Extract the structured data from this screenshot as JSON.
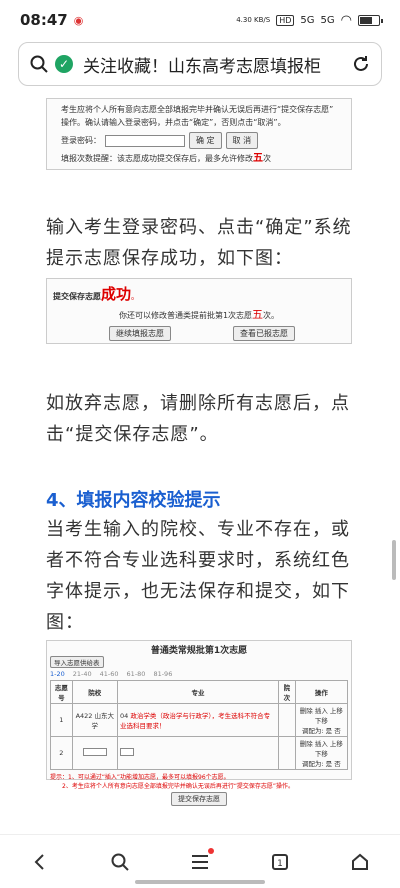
{
  "status": {
    "time": "08:47",
    "speed": "4.30\nKB/S",
    "net1": "HD",
    "net2": "5G",
    "net3": "5G"
  },
  "urlbar": {
    "text": "关注收藏！山东高考志愿填报柜"
  },
  "shot1": {
    "line1": "考生应将个人所有意向志愿全部填报完毕并确认无误后再进行“提交保存志愿”",
    "line2": "操作。确认请输入登录密码，并点击“确定”，否则点击“取消”。",
    "pw_label": "登录密码：",
    "ok": "确 定",
    "cancel": "取 消",
    "reminder_pre": "填报次数提醒：该志愿成功提交保存后，最多允许修改",
    "reminder_num": "五",
    "reminder_post": "次"
  },
  "para1": "输入考生登录密码、点击“确定”系统提示志愿保存成功，如下图：",
  "shot2": {
    "title_pre": "提交保存志愿",
    "title_big": "成功",
    "title_dot": "。",
    "msg_pre": "你还可以修改普通类提前批第1次志愿",
    "msg_num": "五",
    "msg_post": "次。",
    "btn1": "继续填报志愿",
    "btn2": "查看已报志愿"
  },
  "para2": "如放弃志愿，请删除所有志愿后，点击“提交保存志愿”。",
  "heading": "4、填报内容校验提示",
  "para3": "当考生输入的院校、专业不存在，或者不符合专业选科要求时，系统红色字体提示，也无法保存和提交，如下图：",
  "shot3": {
    "title": "普通类常规批第1次志愿",
    "import_btn": "导入志愿供给表",
    "tabs": [
      "1-20",
      "21-40",
      "41-60",
      "61-80",
      "81-96"
    ],
    "headers": [
      "志愿号",
      "院校",
      "专业",
      "院次",
      "操作"
    ],
    "row1": {
      "no": "1",
      "code": "A422",
      "school": "山东大学",
      "major_code": "04",
      "major": "政治学类（政治学与行政学），考生选科不符合专业选科目要求！",
      "ops1": "删除 插入 上移 下移",
      "ops2": "调配为: 是 否"
    },
    "row2": {
      "no": "2",
      "ops1": "删除 插入 上移 下移",
      "ops2": "调配为: 是 否"
    },
    "hint1": "提示：1、可以通过“插入”功能增加志愿，最多可以填报96个志愿。",
    "hint2": "2、考生应将个人所有意向志愿全部填报完毕并确认无误后再进行“提交保存志愿”操作。",
    "submit": "提交保存志愿"
  }
}
